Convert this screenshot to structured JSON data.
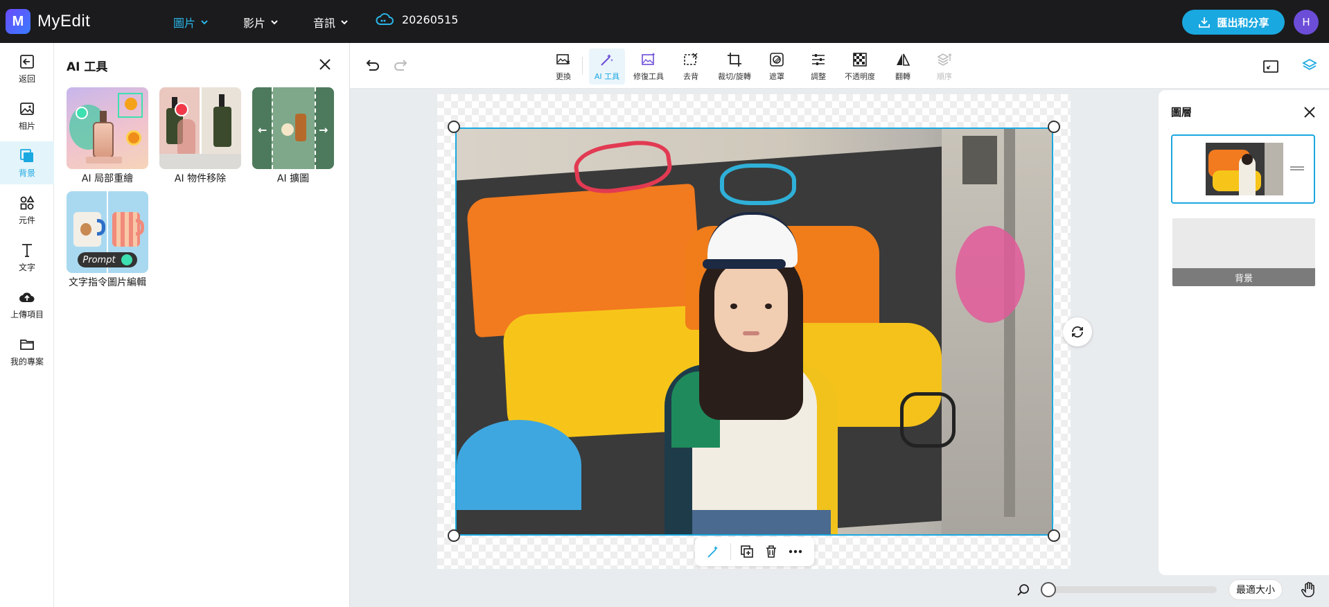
{
  "app": {
    "name": "MyEdit"
  },
  "nav": {
    "image": "圖片",
    "video": "影片",
    "audio": "音訊"
  },
  "project": {
    "name": "20260515"
  },
  "header": {
    "export_label": "匯出和分享",
    "avatar_initial": "H"
  },
  "rail": {
    "back": "返回",
    "photos": "相片",
    "background": "背景",
    "elements": "元件",
    "text": "文字",
    "upload": "上傳項目",
    "projects": "我的專案"
  },
  "panel": {
    "title": "AI 工具",
    "tools": [
      {
        "label": "AI 局部重繪"
      },
      {
        "label": "AI 物件移除"
      },
      {
        "label": "AI 擴圖"
      },
      {
        "label": "文字指令圖片編輯",
        "badge": "Prompt"
      }
    ]
  },
  "toolbar": {
    "replace": "更換",
    "ai_tools": "AI 工具",
    "retouch": "修復工具",
    "remove_bg": "去背",
    "crop": "裁切/旋轉",
    "mask": "遮罩",
    "adjust": "調整",
    "opacity": "不透明度",
    "flip": "翻轉",
    "order": "順序"
  },
  "layers": {
    "title": "圖層",
    "background_label": "背景"
  },
  "zoom": {
    "fit_label": "最適大小",
    "level": 0
  },
  "colors": {
    "accent": "#1aa8e0",
    "topbar": "#1b1b1d",
    "avatar": "#6c4dd8"
  }
}
